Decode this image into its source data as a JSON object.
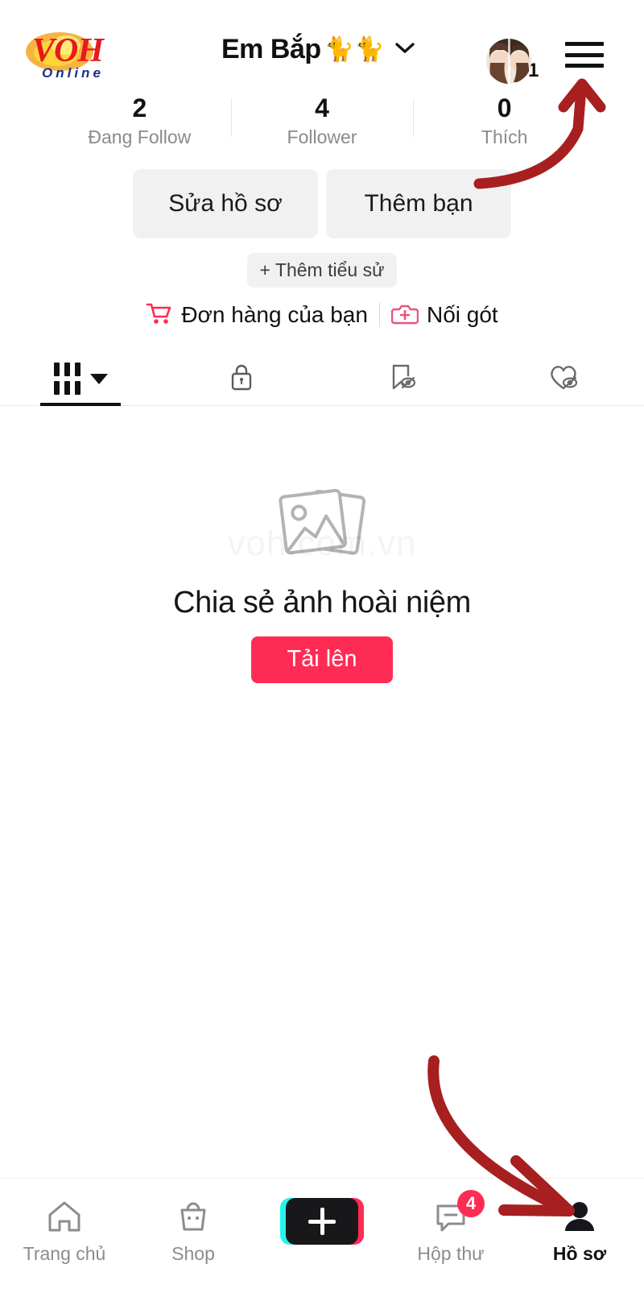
{
  "header": {
    "logo_text": "VOH",
    "logo_subtext": "Online",
    "logo_name": "voh-online-logo",
    "username": "Em Bắp",
    "username_emoji": "🐈🐈",
    "chevron_icon": "chevron-down-icon",
    "avatar_badge_count": "1",
    "menu_icon": "hamburger-menu-icon"
  },
  "stats": [
    {
      "value": "2",
      "label": "Đang Follow"
    },
    {
      "value": "4",
      "label": "Follower"
    },
    {
      "value": "0",
      "label": "Thích"
    }
  ],
  "actions": {
    "edit_profile": "Sửa hồ sơ",
    "add_friend": "Thêm bạn"
  },
  "bio": {
    "add_bio": "+ Thêm tiểu sử"
  },
  "links": [
    {
      "icon": "shopping-cart-icon",
      "label": "Đơn hàng của bạn"
    },
    {
      "icon": "add-photo-badge-icon",
      "label": "Nối gót"
    }
  ],
  "tabs": [
    {
      "name": "posts-grid",
      "icon": "grid-icon",
      "active": true,
      "has_caret": true
    },
    {
      "name": "private",
      "icon": "lock-icon",
      "active": false,
      "has_caret": false
    },
    {
      "name": "saved-hidden",
      "icon": "bookmark-hidden-icon",
      "active": false,
      "has_caret": false
    },
    {
      "name": "liked-hidden",
      "icon": "heart-hidden-icon",
      "active": false,
      "has_caret": false
    }
  ],
  "empty_state": {
    "icon": "photo-stack-icon",
    "title": "Chia sẻ ảnh hoài niệm",
    "button_label": "Tải lên",
    "watermark": "voh.com.vn"
  },
  "bottom_nav": [
    {
      "label": "Trang chủ",
      "icon": "home-icon",
      "active": false,
      "badge": ""
    },
    {
      "label": "Shop",
      "icon": "shopping-bag-icon",
      "active": false,
      "badge": ""
    },
    {
      "label": "",
      "icon": "create-plus-icon",
      "active": false,
      "badge": ""
    },
    {
      "label": "Hộp thư",
      "icon": "message-icon",
      "active": false,
      "badge": "4"
    },
    {
      "label": "Hồ sơ",
      "icon": "person-icon",
      "active": true,
      "badge": ""
    }
  ],
  "annotations": [
    {
      "name": "arrow-to-menu",
      "color": "#a81f1f"
    },
    {
      "name": "arrow-to-profile-tab",
      "color": "#a81f1f"
    }
  ],
  "colors": {
    "accent_pink": "#fe2c55",
    "accent_cyan": "#25f4ee",
    "arrow_red": "#a81f1f",
    "grey_button": "#f1f1f2",
    "muted_text": "#8a8a8a"
  }
}
